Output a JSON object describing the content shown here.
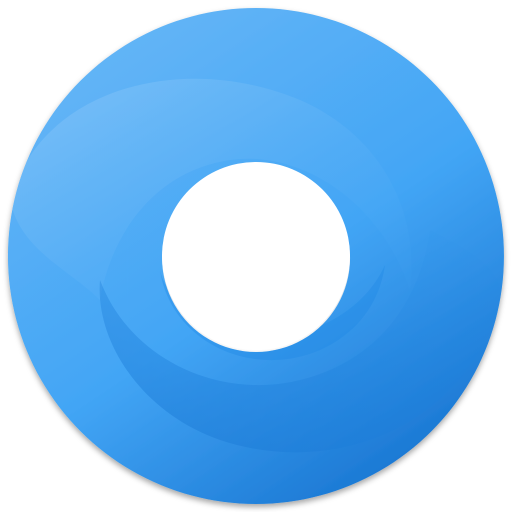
{
  "logo": {
    "icon": "ring-swirl-logo-icon",
    "colors": {
      "light": "#64b5f6",
      "mid": "#42a5f5",
      "dark": "#1e88e5",
      "deep": "#1976d2",
      "highlight": "#90caf9",
      "center": "#ffffff"
    }
  }
}
